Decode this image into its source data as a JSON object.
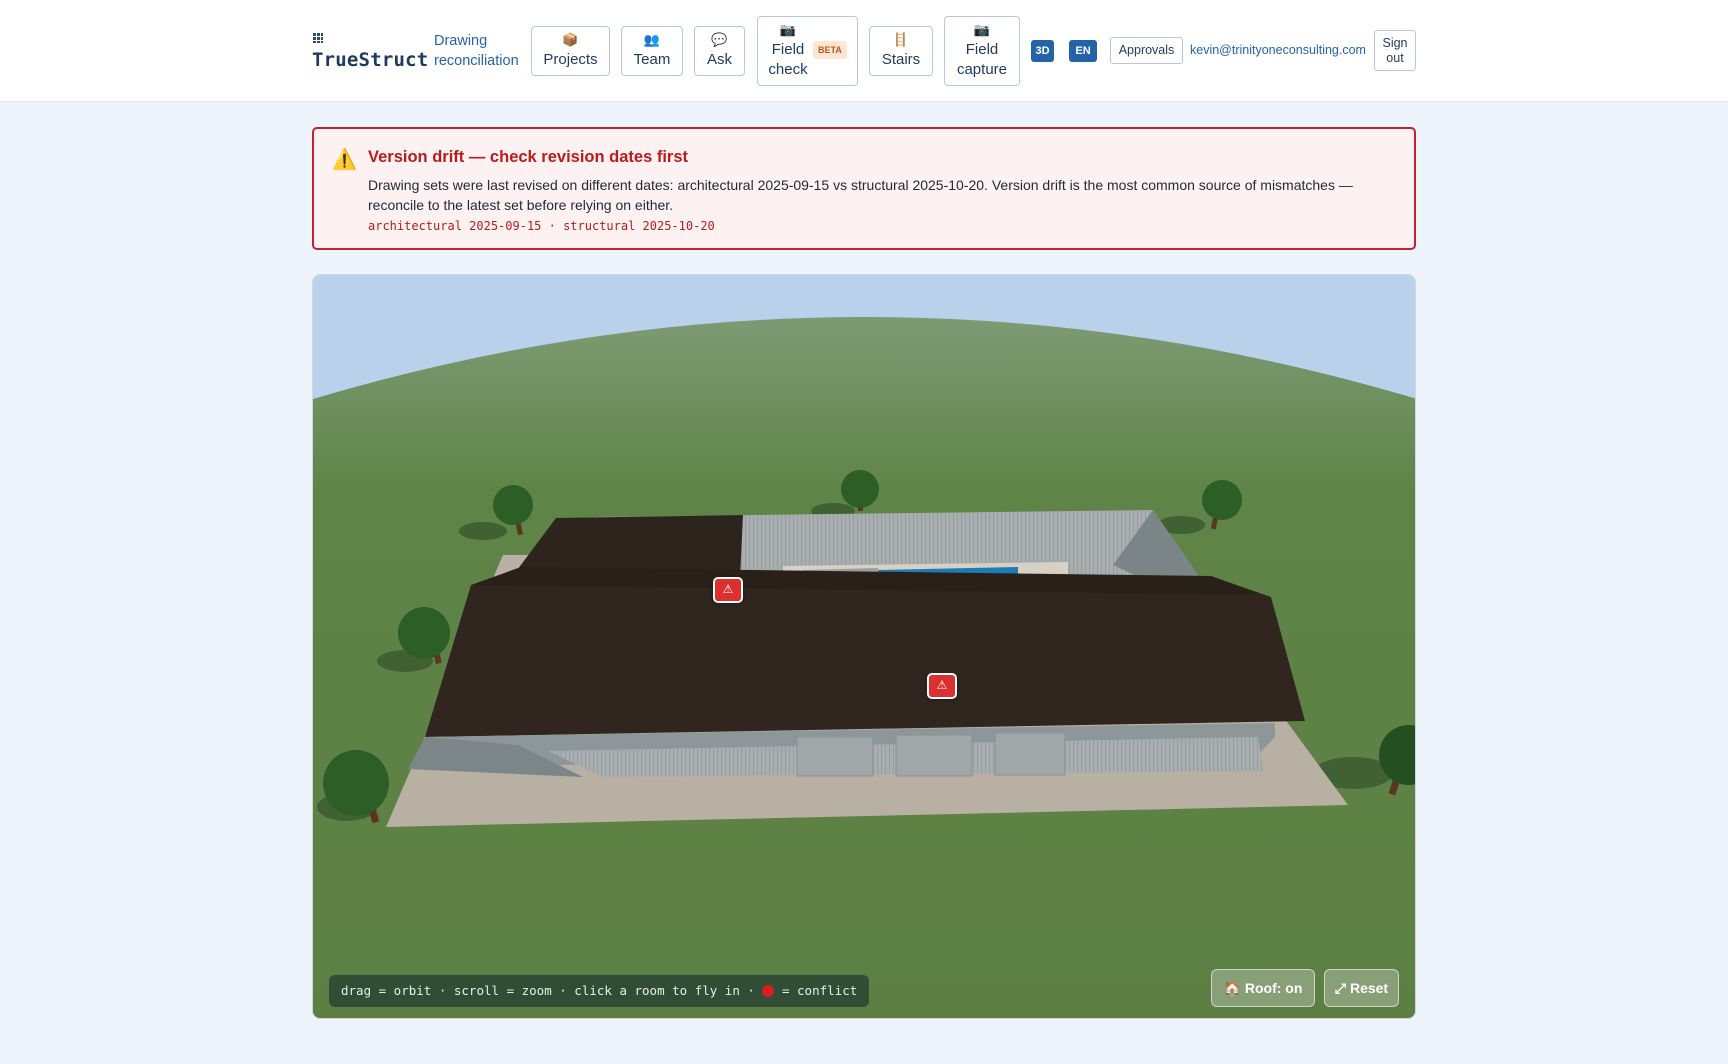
{
  "header": {
    "brand": "TrueStruct",
    "subtitle": "Drawing reconciliation",
    "nav": {
      "projects": {
        "icon": "📦",
        "label": "Projects"
      },
      "team": {
        "icon": "👥",
        "label": "Team"
      },
      "ask": {
        "icon": "💬",
        "label": "Ask"
      },
      "field_check": {
        "icon": "📷",
        "label": "Field check",
        "badge": "BETA"
      },
      "stairs": {
        "icon": "🪜",
        "label": "Stairs"
      },
      "field_capture": {
        "icon": "📷",
        "label": "Field capture"
      }
    },
    "view_chip": "3D",
    "lang_chip": "EN",
    "approvals": "Approvals",
    "user_email": "kevin@trinityoneconsulting.com",
    "signout": "Sign out"
  },
  "alert": {
    "icon": "⚠️",
    "title": "Version drift — check revision dates first",
    "body": "Drawing sets were last revised on different dates: architectural 2025-09-15 vs structural 2025-10-20. Version drift is the most common source of mismatches — reconcile to the latest set before relying on either.",
    "detail": "architectural 2025-09-15 · structural 2025-10-20"
  },
  "viewer": {
    "hint_prefix": "drag = orbit · scroll = zoom · click a room to fly in ·",
    "hint_suffix": "= conflict",
    "roof_toggle": "🏠 Roof: on",
    "reset": "⤢ Reset",
    "conflict_marker_icon": "⚠",
    "conflict_count": 2
  },
  "colors": {
    "sky": "#b9d1eb",
    "ground": "#5d7f44",
    "roof": "#30251f",
    "conflict": "#dc2f2f",
    "accent": "#2563a8"
  }
}
